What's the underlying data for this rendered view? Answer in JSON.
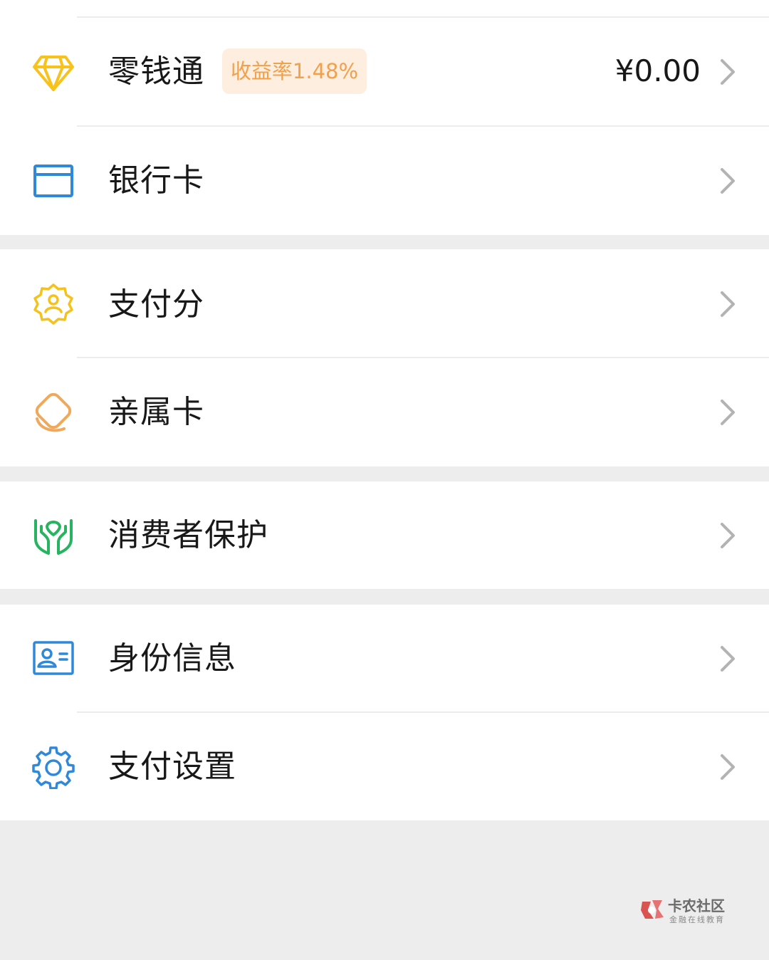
{
  "items": [
    {
      "label": "零钱通",
      "icon": "diamond-icon",
      "badge": "收益率1.48%",
      "amount": "¥0.00"
    },
    {
      "label": "银行卡",
      "icon": "bank-card-icon"
    },
    {
      "label": "支付分",
      "icon": "pay-score-badge-icon"
    },
    {
      "label": "亲属卡",
      "icon": "family-card-icon"
    },
    {
      "label": "消费者保护",
      "icon": "protection-hands-icon"
    },
    {
      "label": "身份信息",
      "icon": "id-card-icon"
    },
    {
      "label": "支付设置",
      "icon": "gear-icon"
    }
  ],
  "watermark": {
    "title": "卡农社区",
    "subtitle": "金融在线教育"
  },
  "colors": {
    "background": "#ededed",
    "row": "#ffffff",
    "diamond": "#f7c21b",
    "card_blue": "#2f88d8",
    "pay_score": "#f4c21d",
    "family_card": "#f0a95a",
    "protection": "#27b35f",
    "badge_bg": "#fdeee0",
    "badge_text": "#f2a049"
  }
}
